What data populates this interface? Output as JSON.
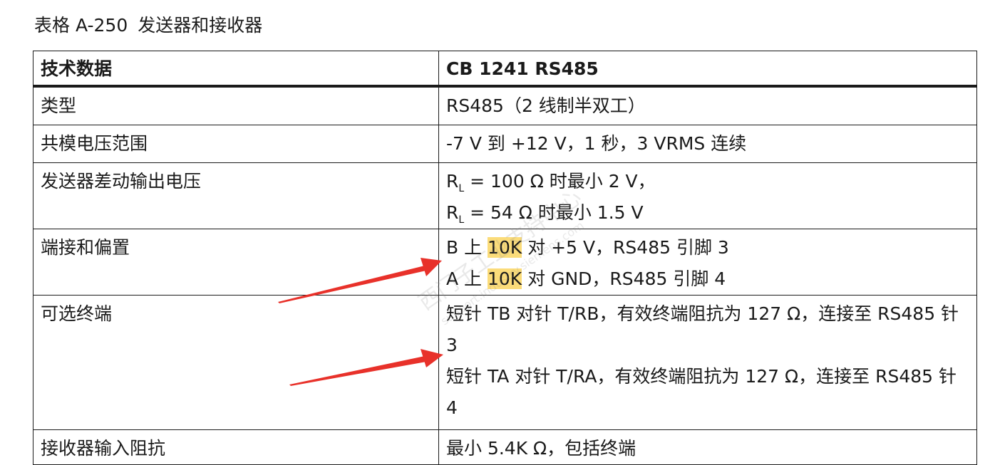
{
  "caption": {
    "label": "表格 A-250",
    "title": "发送器和接收器"
  },
  "table": {
    "header": {
      "col1": "技术数据",
      "col2": "CB 1241 RS485"
    },
    "rows": [
      {
        "param": "类型",
        "value": "RS485（2 线制半双工）"
      },
      {
        "param": "共模电压范围",
        "value": "-7 V 到 +12 V，1 秒，3 VRMS 连续"
      },
      {
        "param": "发送器差动输出电压",
        "line1": {
          "r": "R",
          "sub": "L",
          "rest": " = 100 Ω 时最小 2 V，"
        },
        "line2": {
          "r": "R",
          "sub": "L",
          "rest": " = 54 Ω 时最小 1.5 V"
        }
      },
      {
        "param": "端接和偏置",
        "line1": {
          "pre": "B 上 ",
          "hl": "10K",
          "post": " 对 +5 V，RS485 引脚 3"
        },
        "line2": {
          "pre": "A 上 ",
          "hl": "10K",
          "post": " 对 GND，RS485 引脚 4"
        }
      },
      {
        "param": "可选终端",
        "line1": "短针 TB 对针 T/RB，有效终端阻抗为 127 Ω，连接至 RS485 针 3",
        "line2": "短针 TA 对针 T/RA，有效终端阻抗为 127 Ω，连接至 RS485 针 4"
      },
      {
        "param": "接收器输入阻抗",
        "value": "最小 5.4K Ω，包括终端"
      }
    ]
  },
  "watermark": {
    "line1": "西门子工业支持中心",
    "line2": "support.industry.siemens.com"
  },
  "colors": {
    "highlight": "#fbdc7a",
    "arrow": "#e8312a",
    "border": "#1a1a1a"
  }
}
